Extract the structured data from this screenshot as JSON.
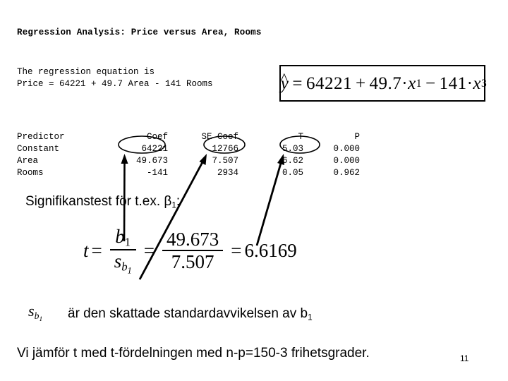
{
  "slide": {
    "page_number": "11"
  },
  "output": {
    "analysis_title": "Regression Analysis: Price versus Area, Rooms",
    "equation_intro_line1": "The regression equation is",
    "equation_intro_line2": "Price = 64221 + 49.7 Area - 141 Rooms",
    "table": {
      "headers": {
        "predictor": "Predictor",
        "coef": "Coef",
        "se_coef": "SE Coef",
        "t": "T",
        "p": "P"
      },
      "rows": [
        {
          "predictor": "Constant",
          "coef": "64221",
          "se_coef": "12766",
          "t": "5.03",
          "p": "0.000"
        },
        {
          "predictor": "Area",
          "coef": "49.673",
          "se_coef": "7.507",
          "t": "6.62",
          "p": "0.000"
        },
        {
          "predictor": "Rooms",
          "coef": "-141",
          "se_coef": "2934",
          "t": "0.05",
          "p": "0.962"
        }
      ]
    }
  },
  "hat_equation": {
    "lhs": "y",
    "hat": "^",
    "equals": "=",
    "intercept": "64221",
    "plus": "+",
    "coef1": "49.7",
    "dot": "·",
    "var1": "x",
    "var1_sub": "1",
    "minus": "−",
    "coef3": "141",
    "var3": "x",
    "var3_sub": "3"
  },
  "body": {
    "significance_label_pre": "Signifikanstest för t.ex. ",
    "significance_beta": "β",
    "significance_beta_sub": "1",
    "significance_label_post": ":",
    "sb_symbol_s": "s",
    "sb_symbol_b": "b",
    "sb_symbol_sub": "1",
    "sb_description": "är den skattade standardavvikelsen av b",
    "sb_description_sub": "1",
    "comparison_line": "Vi jämför t med t-fördelningen med n-p=150-3 frihetsgrader."
  },
  "t_formula": {
    "t": "t",
    "equals1": "=",
    "num1": "b",
    "num1_sub": "1",
    "den1_s": "s",
    "den1_b": "b",
    "den1_sub": "1",
    "equals2": "=",
    "num2": "49.673",
    "den2": "7.507",
    "equals3": "=",
    "result": "6.6169"
  },
  "annotations": {
    "ellipse_coef_label": "49.673",
    "ellipse_se_label": "7.507",
    "ellipse_t_label": "6.62",
    "arrow_coef": "arrow-to-coef",
    "arrow_se": "arrow-to-se-coef",
    "arrow_t": "arrow-to-t-value"
  },
  "colors": {
    "ink": "#000000",
    "background": "#ffffff"
  }
}
